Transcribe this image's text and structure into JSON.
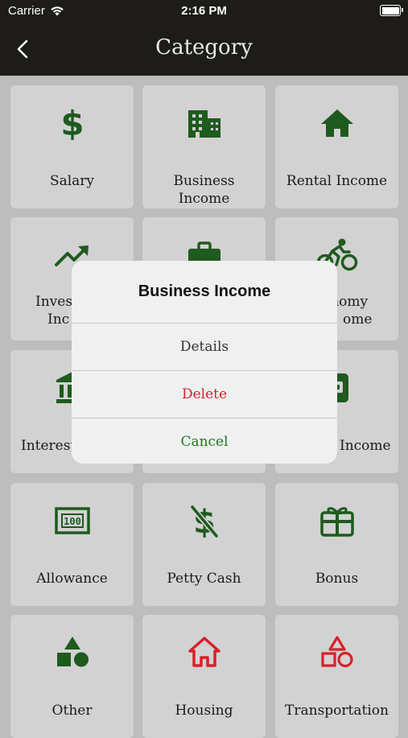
{
  "status_bar": {
    "carrier": "Carrier",
    "time": "2:16 PM"
  },
  "nav": {
    "title": "Category",
    "back_icon": "chevron-left-icon"
  },
  "colors": {
    "icon_green": "#1f5a1f",
    "icon_red": "#d9202a",
    "nav_bg": "#1e1c18"
  },
  "categories": [
    {
      "label": "Salary",
      "icon": "dollar-icon"
    },
    {
      "label": "Business Income",
      "icon": "building-icon"
    },
    {
      "label": "Rental Income",
      "icon": "house-icon"
    },
    {
      "label": "Investment Income",
      "label_visible": [
        "Invest",
        "Inc"
      ],
      "icon": "trend-up-icon"
    },
    {
      "label": "",
      "icon": "briefcase-icon"
    },
    {
      "label": "Gig Economy Income",
      "label_visible": [
        "onomy",
        "ome"
      ],
      "icon": "bicycle-icon"
    },
    {
      "label": "Interest",
      "label_visible": "Interest",
      "icon": "bank-icon"
    },
    {
      "label": "",
      "icon": ""
    },
    {
      "label": "Income",
      "label_visible": "Income",
      "icon": "wallet-icon"
    },
    {
      "label": "Allowance",
      "icon": "banknote-icon"
    },
    {
      "label": "Petty Cash",
      "icon": "dollar-strike-icon"
    },
    {
      "label": "Bonus",
      "icon": "gift-card-icon"
    },
    {
      "label": "Other",
      "icon": "shapes-icon"
    },
    {
      "label": "Housing",
      "icon": "house-outline-icon"
    },
    {
      "label": "Transportation",
      "icon": "shapes-outline-icon"
    }
  ],
  "alert": {
    "title": "Business Income",
    "details_label": "Details",
    "delete_label": "Delete",
    "cancel_label": "Cancel"
  }
}
